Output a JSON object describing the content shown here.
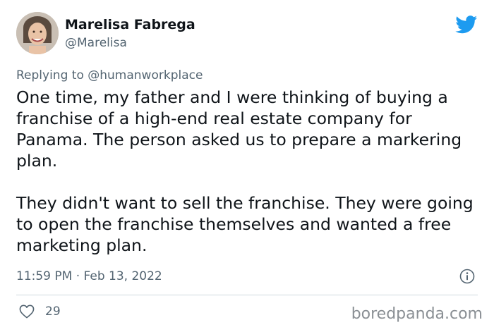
{
  "tweet": {
    "author_name": "Marelisa Fabrega",
    "author_handle": "@Marelisa",
    "replying_prefix": "Replying to",
    "replying_to": "@humanworkplace",
    "paragraphs": [
      "One time, my father and I were thinking of buying a franchise of a high-end real estate company for Panama. The person asked us to prepare a markering plan.",
      "They didn't want to sell the franchise. They were going to open the franchise themselves and wanted a free marketing plan."
    ],
    "timestamp": "11:59 PM · Feb 13, 2022",
    "likes": "29"
  },
  "icons": {
    "brand": "twitter-bird-icon",
    "info": "info-icon",
    "like": "heart-icon"
  },
  "colors": {
    "twitter_blue": "#1d9bf0",
    "text": "#0f1419",
    "muted": "#536471",
    "divider": "#cfd9de"
  },
  "watermark": "boredpanda.com"
}
